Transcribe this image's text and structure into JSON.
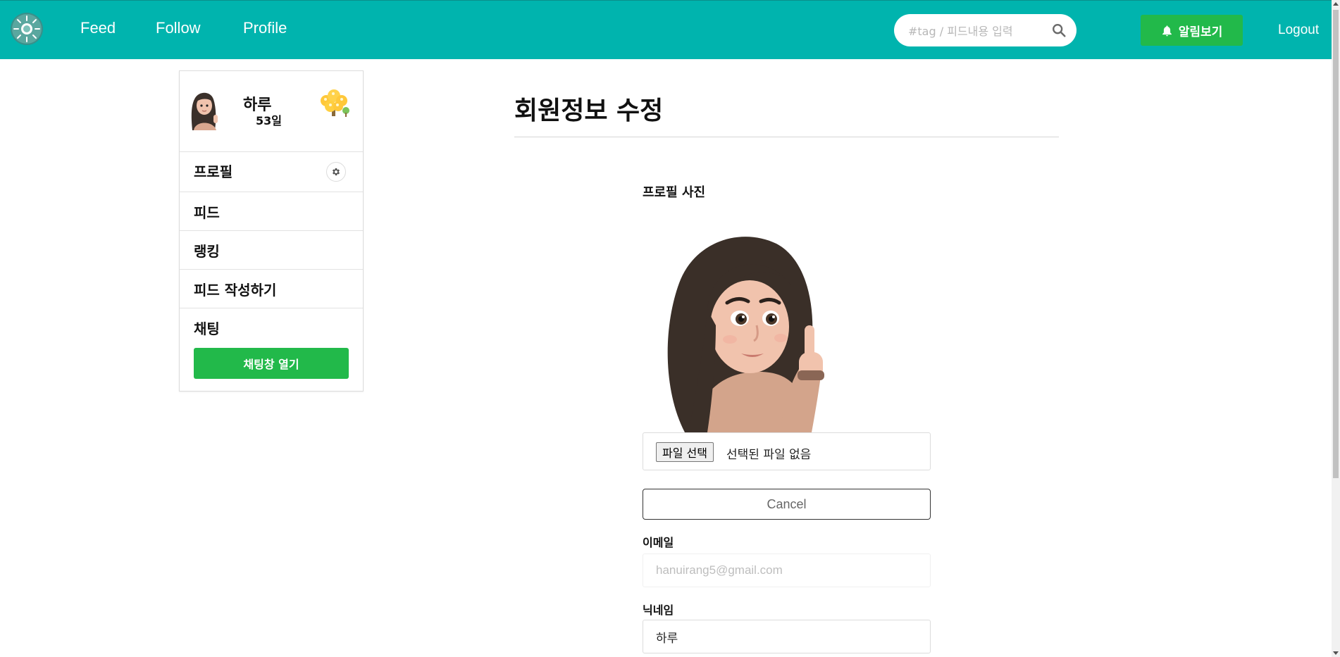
{
  "nav": {
    "links": [
      "Feed",
      "Follow",
      "Profile"
    ],
    "search_placeholder": "#tag / 피드내용 입력",
    "alarm_label": "알림보기",
    "logout_label": "Logout"
  },
  "colors": {
    "nav_bg": "#00b4ae",
    "accent_green": "#22b94a"
  },
  "sidebar": {
    "user_name": "하루",
    "days": "53일",
    "menu": [
      "프로필",
      "피드",
      "랭킹",
      "피드 작성하기",
      "채팅"
    ],
    "chat_open_label": "채팅창 열기"
  },
  "main": {
    "title": "회원정보 수정",
    "photo_label": "프로필 사진",
    "file_button": "파일 선택",
    "file_status": "선택된 파일 없음",
    "cancel_label": "Cancel",
    "email_label": "이메일",
    "email_value": "hanuirang5@gmail.com",
    "nickname_label": "닉네임",
    "nickname_value": "하루"
  }
}
